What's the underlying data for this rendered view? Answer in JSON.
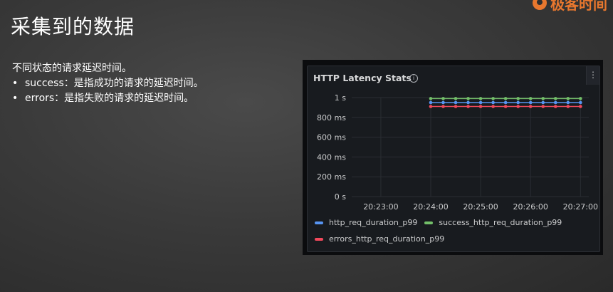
{
  "slide": {
    "title": "采集到的数据",
    "logo_text": "极客时间",
    "intro": "不同状态的请求延迟时间。",
    "bullets": [
      "success：是指成功的请求的延迟时间。",
      "errors：是指失败的请求的延迟时间。"
    ]
  },
  "panel": {
    "title": "HTTP Latency Stats",
    "info_icon": "info-icon",
    "menu_icon": "vertical-ellipsis-icon",
    "menu_label": "⋮"
  },
  "colors": {
    "success": "#73bf69",
    "p99": "#5794f2",
    "errors": "#f2495c",
    "accent": "#e8772e"
  },
  "chart_data": {
    "type": "line",
    "title": "HTTP Latency Stats",
    "xlabel": "",
    "ylabel": "",
    "ylim": [
      0,
      1000
    ],
    "yticks": [
      {
        "value": 1000,
        "label": "1 s"
      },
      {
        "value": 800,
        "label": "800 ms"
      },
      {
        "value": 600,
        "label": "600 ms"
      },
      {
        "value": 400,
        "label": "400 ms"
      },
      {
        "value": 200,
        "label": "200 ms"
      },
      {
        "value": 0,
        "label": "0 s"
      }
    ],
    "xlim": [
      "20:22:25",
      "20:27:10"
    ],
    "xticks": [
      "20:23:00",
      "20:24:00",
      "20:25:00",
      "20:26:00",
      "20:27:00"
    ],
    "x": [
      "20:24:00",
      "20:24:15",
      "20:24:30",
      "20:24:45",
      "20:25:00",
      "20:25:15",
      "20:25:30",
      "20:25:45",
      "20:26:00",
      "20:26:15",
      "20:26:30",
      "20:26:45",
      "20:27:00"
    ],
    "grid": true,
    "legend_position": "bottom",
    "series": [
      {
        "name": "http_req_duration_p99",
        "color": "#5794f2",
        "values": [
          950,
          950,
          950,
          950,
          950,
          950,
          950,
          950,
          950,
          950,
          950,
          950,
          950
        ]
      },
      {
        "name": "success_http_req_duration_p99",
        "color": "#73bf69",
        "values": [
          990,
          990,
          990,
          990,
          990,
          990,
          990,
          990,
          990,
          990,
          990,
          990,
          990
        ]
      },
      {
        "name": "errors_http_req_duration_p99",
        "color": "#f2495c",
        "values": [
          910,
          910,
          910,
          910,
          910,
          910,
          910,
          910,
          910,
          910,
          910,
          910,
          910
        ]
      }
    ]
  }
}
